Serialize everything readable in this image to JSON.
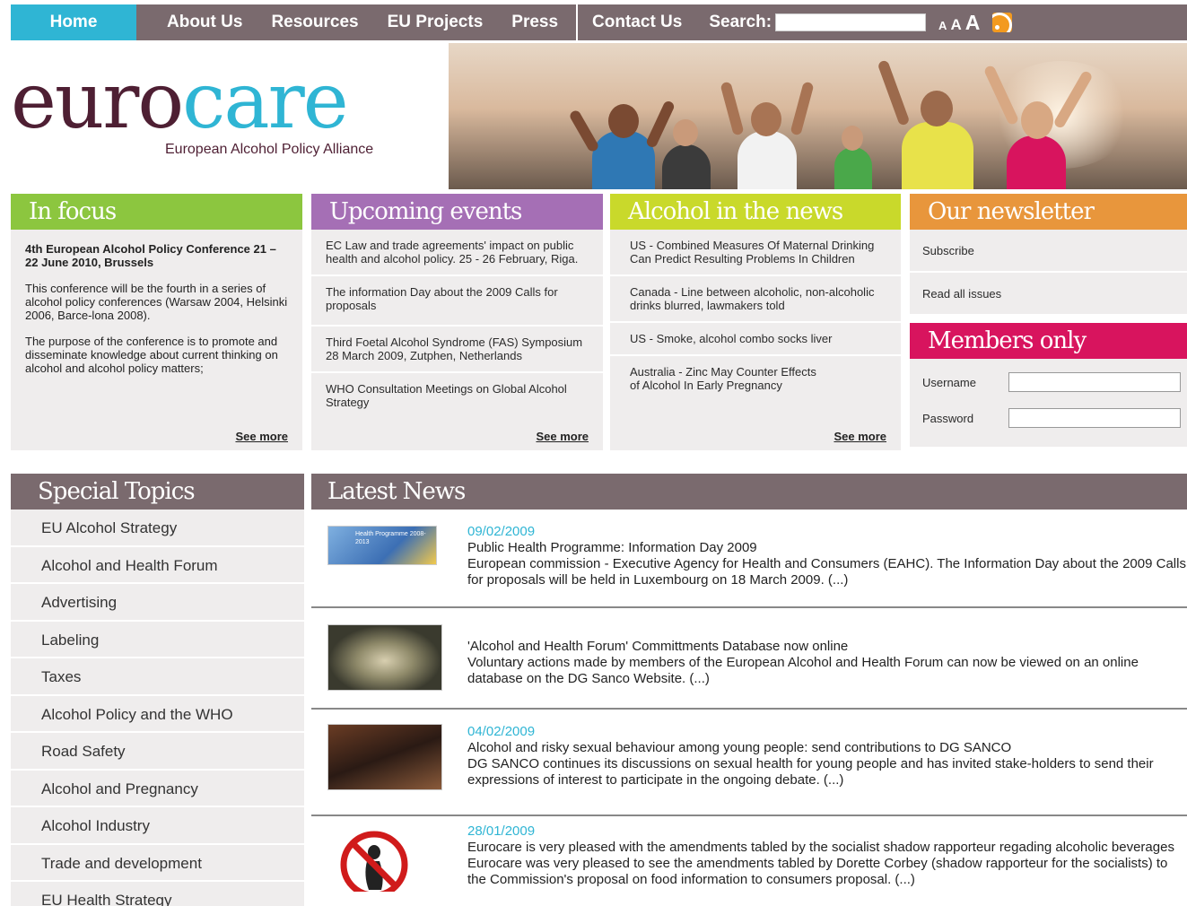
{
  "nav": {
    "items": [
      "Home",
      "About Us",
      "Resources",
      "EU Projects",
      "Press",
      "Contact Us"
    ],
    "search_label": "Search:",
    "font_sizes": [
      "A",
      "A",
      "A"
    ]
  },
  "logo": {
    "euro": "euro",
    "care": "care",
    "tagline": "European Alcohol Policy Alliance"
  },
  "in_focus": {
    "title": "In focus",
    "headline": "4th European Alcohol Policy Conference 21 – 22 June 2010, Brussels",
    "para1": "This conference will be the fourth in a series of alcohol policy conferences (Warsaw 2004, Helsinki 2006, Barce-lona 2008).",
    "para2": "The purpose of the conference is to promote and disseminate knowledge about current thinking on alcohol and alcohol policy matters;",
    "see_more": "See more"
  },
  "events": {
    "title": "Upcoming events",
    "items": [
      "EC Law and trade agreements' impact on public health and alcohol policy. 25 - 26 February, Riga.",
      "The information Day about the 2009 Calls for proposals",
      "Third Foetal Alcohol Syndrome (FAS) Symposium 28 March 2009, Zutphen, Netherlands",
      "WHO Consultation Meetings on Global Alcohol Strategy"
    ],
    "see_more": "See more"
  },
  "news_box": {
    "title": "Alcohol in the news",
    "items": [
      "US - Combined Measures Of Maternal Drinking Can Predict Resulting Problems In Children",
      "Canada - Line between alcoholic, non-alcoholic drinks blurred, lawmakers told",
      "US - Smoke, alcohol combo socks liver",
      "Australia - Zinc May Counter Effects of Alcohol In Early Pregnancy"
    ],
    "see_more": "See more"
  },
  "newsletter": {
    "title": "Our newsletter",
    "subscribe": "Subscribe",
    "read_all": "Read all issues"
  },
  "members": {
    "title": "Members only",
    "username": "Username",
    "password": "Password"
  },
  "topics": {
    "title": "Special Topics",
    "items": [
      "EU Alcohol Strategy",
      "Alcohol and Health Forum",
      "Advertising",
      "Labeling",
      "Taxes",
      "Alcohol Policy and the WHO",
      "Road Safety",
      "Alcohol and Pregnancy",
      "Alcohol Industry",
      "Trade and development",
      "EU Health Strategy"
    ]
  },
  "latest_news": {
    "title": "Latest News",
    "items": [
      {
        "date": "09/02/2009",
        "title": "Public Health Programme: Information Day 2009",
        "body": "European commission - Executive Agency for Health and Consumers (EAHC). The Information Day about the 2009 Calls for proposals will be held in Luxembourg on 18 March 2009. (...)",
        "thumb_label": "Health Programme 2008-2013"
      },
      {
        "date": "",
        "title": "'Alcohol and Health Forum' Committments Database now online",
        "body": "Voluntary actions made by members of the European Alcohol and Health Forum can now be viewed on an online database on the DG Sanco Website. (...)"
      },
      {
        "date": "04/02/2009",
        "title": "Alcohol and risky sexual behaviour among young people: send contributions to DG SANCO",
        "body": "DG SANCO continues its discussions on sexual health for young people and has invited stake-holders to send their expressions of interest to participate in the ongoing debate. (...)"
      },
      {
        "date": "28/01/2009",
        "title": "Eurocare is very pleased with the amendments tabled by the socialist shadow rapporteur regading alcoholic beverages",
        "body": "Eurocare was very pleased to see the amendments tabled by Dorette Corbey (shadow rapporteur for the socialists) to the Commission's proposal on food information to consumers proposal. (...)"
      }
    ]
  },
  "colors": {
    "nav": "#7a6a6e",
    "home": "#2fb5d4",
    "in_focus": "#8cc63f",
    "events": "#a56fb5",
    "news_box": "#c9d92b",
    "newsletter": "#e8963c",
    "members": "#d8145e",
    "date": "#2fb5d4"
  }
}
